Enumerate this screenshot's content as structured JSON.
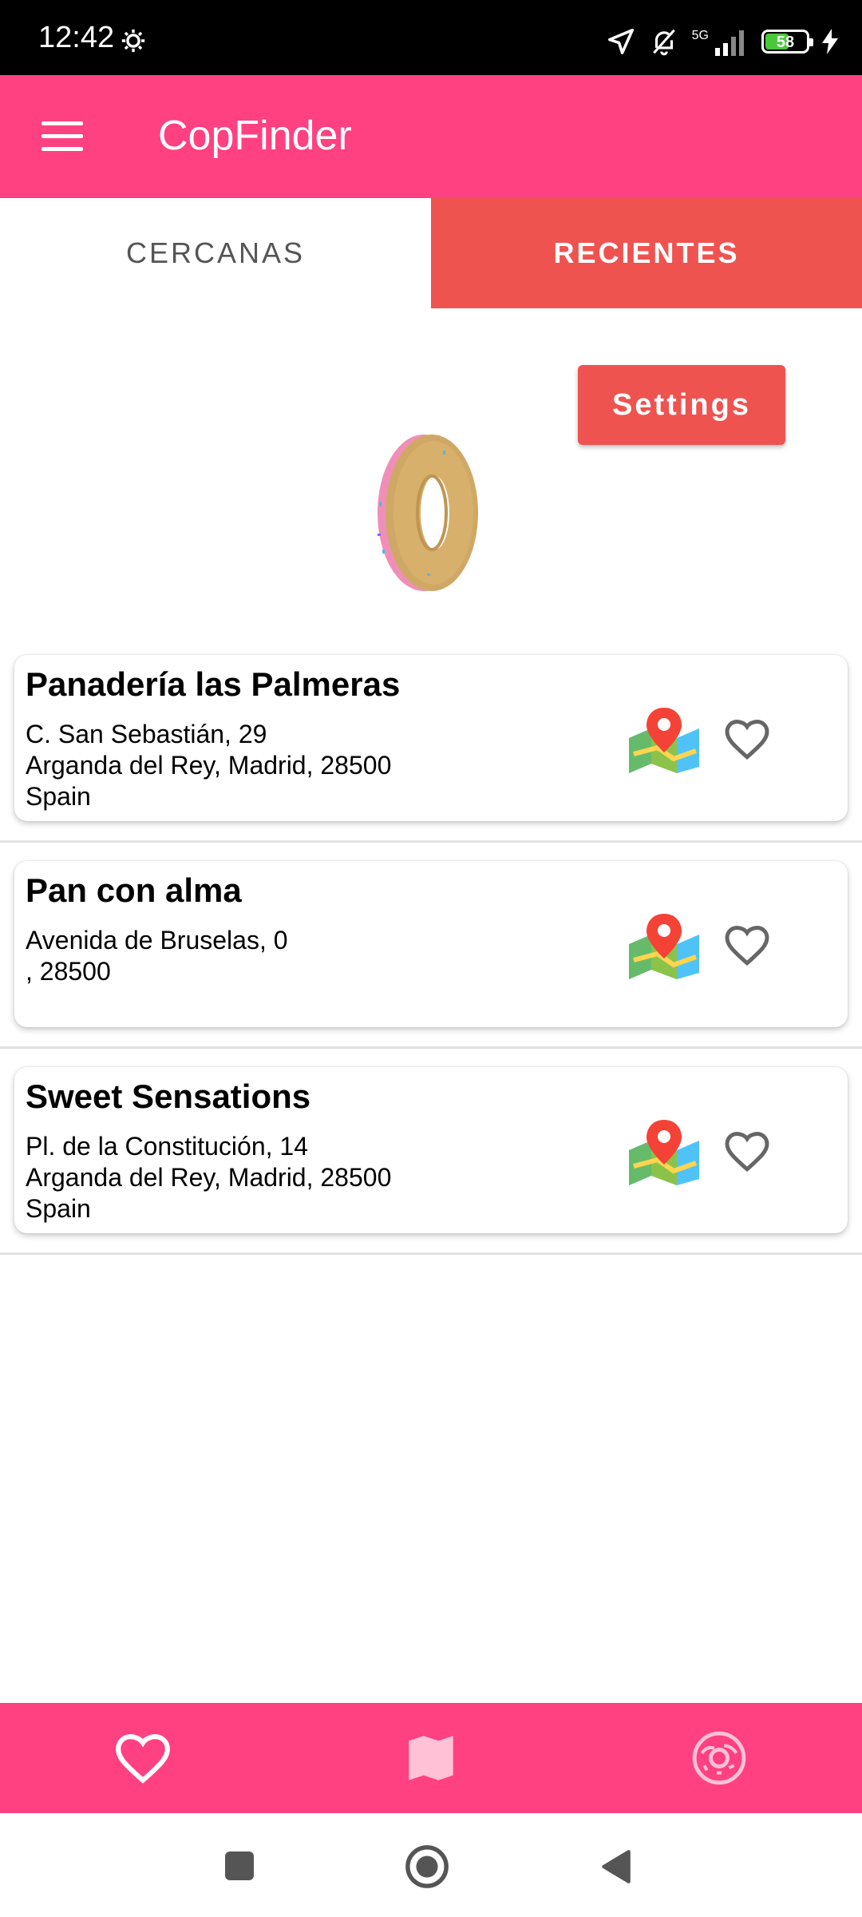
{
  "status_bar": {
    "time": "12:42",
    "network_label": "5G",
    "battery_level": "58",
    "battery_fraction": 0.58
  },
  "app_bar": {
    "title": "CopFinder",
    "menu_icon": "hamburger-menu-icon"
  },
  "tabs": [
    {
      "label": "CERCANAS",
      "active": false
    },
    {
      "label": "RECIENTES",
      "active": true
    }
  ],
  "settings_button": {
    "label": "Settings"
  },
  "places": [
    {
      "name": "Panadería las Palmeras",
      "address_lines": [
        "C. San Sebastián, 29",
        "Arganda del Rey, Madrid, 28500",
        "Spain"
      ]
    },
    {
      "name": "Pan con alma",
      "address_lines": [
        "Avenida de Bruselas, 0",
        ", 28500",
        ""
      ]
    },
    {
      "name": "Sweet Sensations",
      "address_lines": [
        "Pl. de la Constitución, 14",
        "Arganda del Rey, Madrid, 28500",
        "Spain"
      ]
    }
  ],
  "bottom_nav": [
    {
      "icon": "heart-icon",
      "active": true
    },
    {
      "icon": "map-icon",
      "active": false
    },
    {
      "icon": "donut-icon",
      "active": false
    }
  ],
  "colors": {
    "primary": "#ff4081",
    "accent": "#ef5350",
    "battery": "#47c93a"
  }
}
